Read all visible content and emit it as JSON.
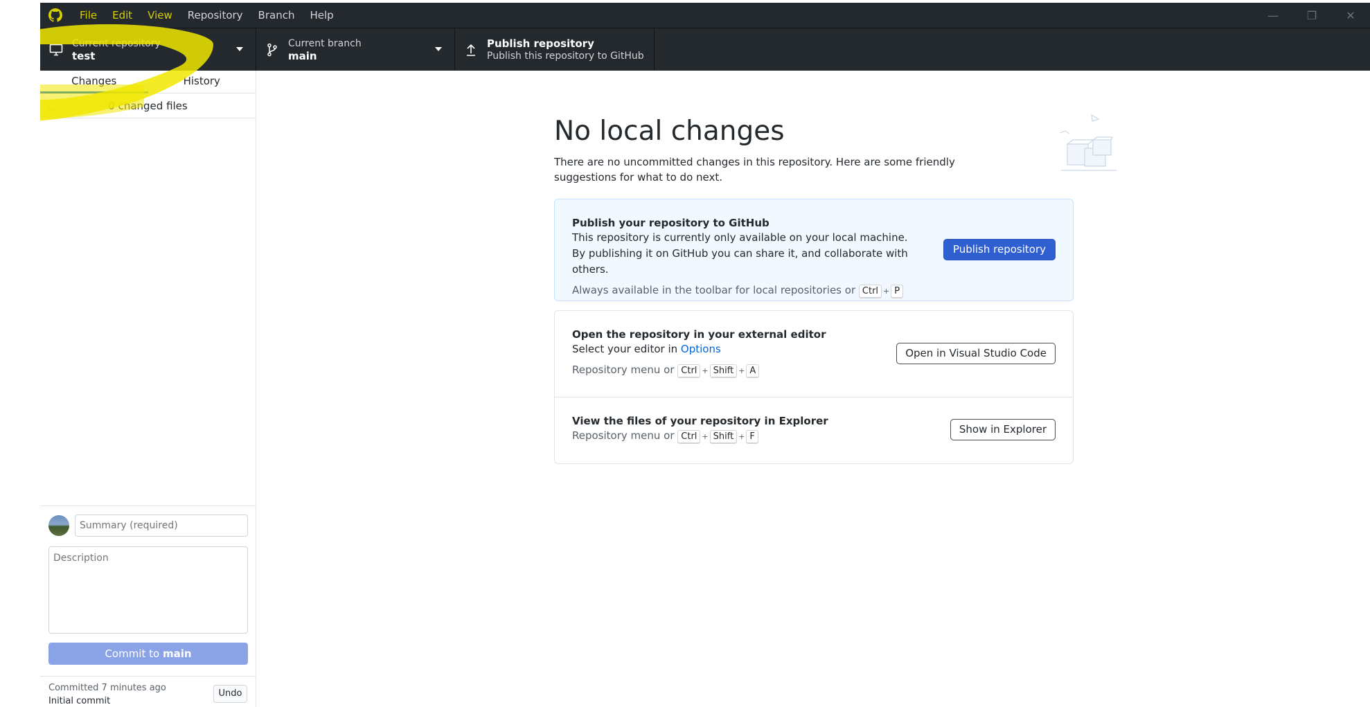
{
  "menu": {
    "items": [
      "File",
      "Edit",
      "View",
      "Repository",
      "Branch",
      "Help"
    ]
  },
  "toolbar": {
    "repo_label": "Current repository",
    "repo_value": "test",
    "branch_label": "Current branch",
    "branch_value": "main",
    "publish_label": "Publish repository",
    "publish_sub": "Publish this repository to GitHub"
  },
  "sidebar": {
    "tabs": [
      "Changes",
      "History"
    ],
    "changed_files": "0 changed files",
    "summary_placeholder": "Summary (required)",
    "description_placeholder": "Description",
    "commit_prefix": "Commit to ",
    "commit_branch": "main",
    "last_commit_time": "Committed 7 minutes ago",
    "last_commit_msg": "Initial commit",
    "undo_label": "Undo"
  },
  "main": {
    "title": "No local changes",
    "subtitle": "There are no uncommitted changes in this repository. Here are some friendly suggestions for what to do next.",
    "publish_card": {
      "title": "Publish your repository to GitHub",
      "text": "This repository is currently only available on your local machine. By publishing it on GitHub you can share it, and collaborate with others.",
      "hint": "Always available in the toolbar for local repositories or",
      "keys": [
        "Ctrl",
        "P"
      ],
      "button": "Publish repository"
    },
    "editor_card": {
      "title": "Open the repository in your external editor",
      "text_prefix": "Select your editor in",
      "text_link": "Options",
      "hint": "Repository menu or",
      "keys": [
        "Ctrl",
        "Shift",
        "A"
      ],
      "button": "Open in Visual Studio Code"
    },
    "explorer_card": {
      "title": "View the files of your repository in Explorer",
      "hint": "Repository menu or",
      "keys": [
        "Ctrl",
        "Shift",
        "F"
      ],
      "button": "Show in Explorer"
    }
  },
  "colors": {
    "chrome": "#24292e",
    "accent": "#0366d6",
    "primary_button": "#2f5fd0",
    "highlight": "#f0e800"
  }
}
